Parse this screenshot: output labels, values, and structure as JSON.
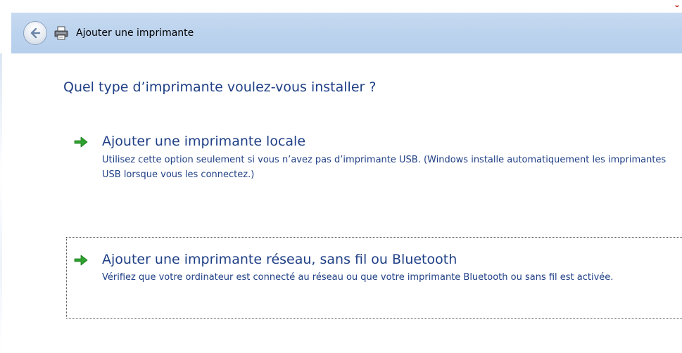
{
  "window": {
    "title": "Ajouter une imprimante"
  },
  "main": {
    "question": "Quel type d’imprimante voulez-vous installer ?",
    "options": [
      {
        "title": "Ajouter une imprimante locale",
        "description": "Utilisez cette option seulement si vous n’avez pas d’imprimante USB. (Windows installe automatiquement les imprimantes USB lorsque vous les connectez.)",
        "icon": "green-arrow-icon"
      },
      {
        "title": "Ajouter une imprimante réseau, sans fil ou Bluetooth",
        "description": "Vérifiez que votre ordinateur est connecté au réseau ou que votre imprimante Bluetooth ou sans fil est activée.",
        "icon": "green-arrow-icon"
      }
    ]
  },
  "colors": {
    "titlebar": "#bcd3ee",
    "heading_text": "#1f3f86",
    "arrow_green": "#2ea12e"
  },
  "icons": {
    "back": "back-arrow-icon",
    "printer": "printer-icon"
  }
}
